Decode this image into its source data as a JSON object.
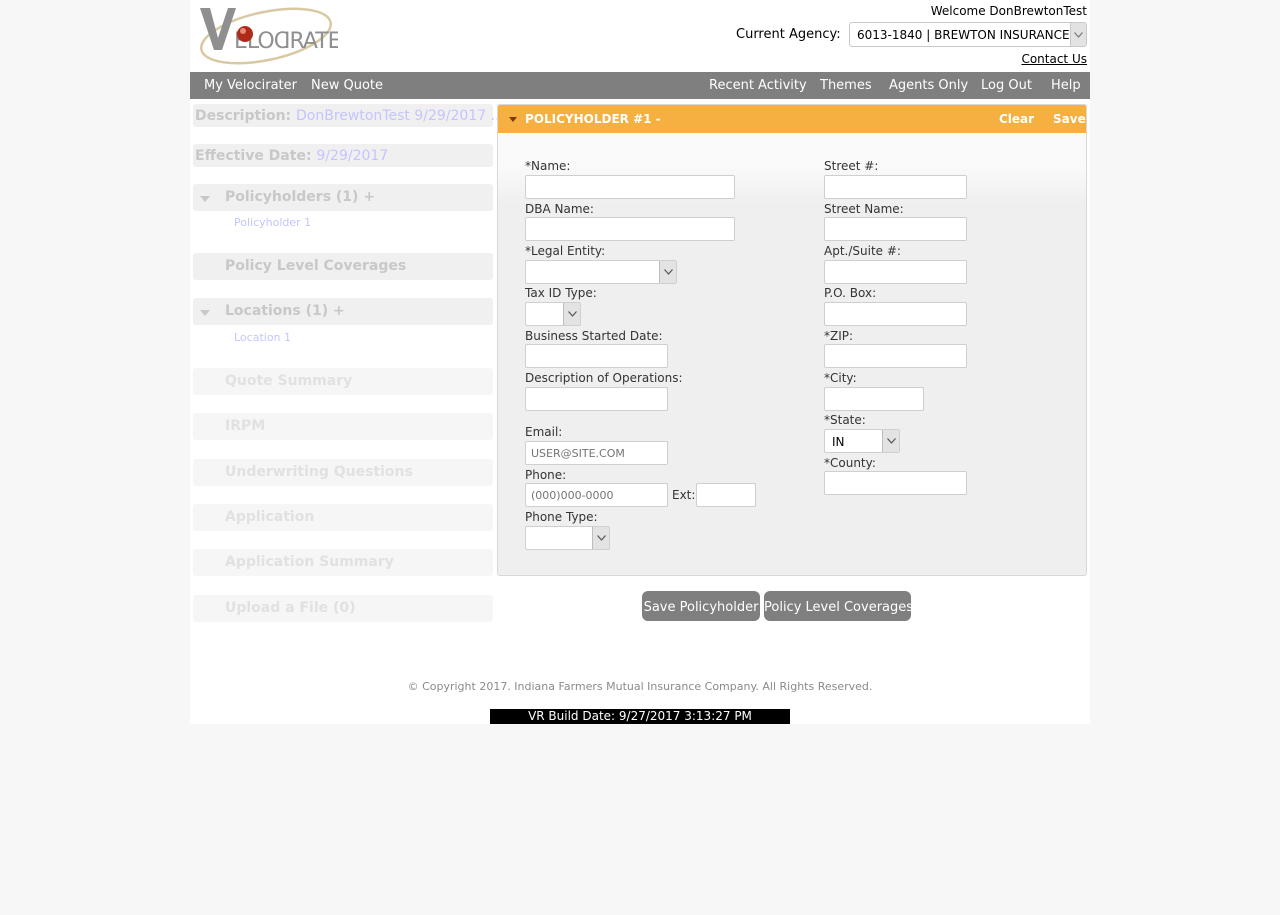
{
  "header": {
    "welcome": "Welcome DonBrewtonTest",
    "agency_label": "Current Agency:",
    "agency_value": "6013-1840 | BREWTON INSURANCE",
    "contact": "Contact Us",
    "logo_text": "VELOCIRATER"
  },
  "nav": {
    "left": [
      "My Velocirater",
      "New Quote"
    ],
    "right": [
      "Recent Activity",
      "Themes",
      "Agents Only",
      "Log Out",
      "Help"
    ]
  },
  "sidebar": {
    "description_label": "Description:",
    "description_value": "DonBrewtonTest 9/29/2017 ...",
    "effective_label": "Effective Date:",
    "effective_value": "9/29/2017",
    "policyholders": "Policyholders (1) +",
    "policyholder_item": "Policyholder 1",
    "policy_level_coverages": "Policy Level Coverages",
    "locations": "Locations (1) +",
    "location_item": "Location 1",
    "quote_summary": "Quote Summary",
    "irpm": "IRPM",
    "underwriting": "Underwriting Questions",
    "application": "Application",
    "application_summary": "Application Summary",
    "upload": "Upload a File (0)"
  },
  "panel": {
    "title": "POLICYHOLDER #1 -",
    "clear": "Clear",
    "save": "Save"
  },
  "form": {
    "name_label": "*Name:",
    "dba_label": "DBA Name:",
    "legal_entity_label": "*Legal Entity:",
    "tax_id_label": "Tax ID Type:",
    "business_started_label": "Business Started Date:",
    "description_ops_label": "Description of Operations:",
    "email_label": "Email:",
    "email_placeholder": "USER@SITE.COM",
    "phone_label": "Phone:",
    "phone_placeholder": "(000)000-0000",
    "ext_label": "Ext:",
    "phone_type_label": "Phone Type:",
    "street_num_label": "Street #:",
    "street_name_label": "Street Name:",
    "apt_label": "Apt./Suite #:",
    "po_box_label": "P.O. Box:",
    "zip_label": "*ZIP:",
    "city_label": "*City:",
    "state_label": "*State:",
    "state_value": "IN",
    "county_label": "*County:"
  },
  "actions": {
    "save_policyholder": "Save Policyholder",
    "policy_level_coverages": "Policy Level Coverages"
  },
  "footer": {
    "copyright": "© Copyright 2017. Indiana Farmers Mutual Insurance Company. All Rights Reserved.",
    "build": "VR Build Date: 9/27/2017 3:13:27 PM"
  }
}
